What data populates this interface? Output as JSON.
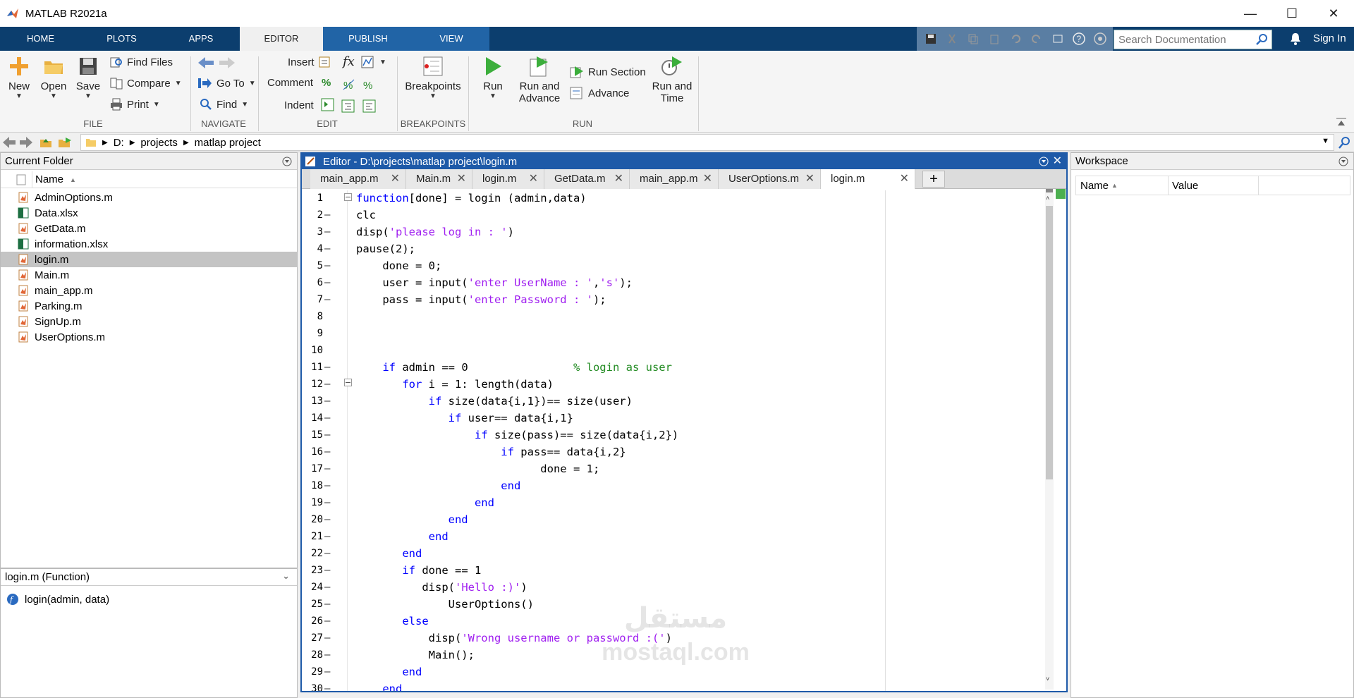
{
  "window": {
    "title": "MATLAB R2021a",
    "controls": {
      "minimize": "—",
      "maximize": "☐",
      "close": "✕"
    }
  },
  "tabs": [
    {
      "label": "HOME"
    },
    {
      "label": "PLOTS"
    },
    {
      "label": "APPS"
    },
    {
      "label": "EDITOR"
    },
    {
      "label": "PUBLISH"
    },
    {
      "label": "VIEW"
    }
  ],
  "search": {
    "placeholder": "Search Documentation"
  },
  "account": {
    "signin": "Sign In"
  },
  "ribbon": {
    "file": {
      "new": "New",
      "open": "Open",
      "save": "Save",
      "find_files": "Find Files",
      "compare": "Compare",
      "print": "Print",
      "section": "FILE"
    },
    "navigate": {
      "goto": "Go To",
      "find": "Find",
      "section": "NAVIGATE"
    },
    "edit": {
      "insert": "Insert",
      "comment": "Comment",
      "indent": "Indent",
      "fx": "fx",
      "pct": "%",
      "section": "EDIT"
    },
    "breakpoints": {
      "label": "Breakpoints",
      "section": "BREAKPOINTS"
    },
    "run": {
      "run": "Run",
      "run_and_advance_1": "Run and",
      "run_and_advance_2": "Advance",
      "run_section": "Run Section",
      "advance": "Advance",
      "run_and_time_1": "Run and",
      "run_and_time_2": "Time",
      "section": "RUN"
    }
  },
  "address": {
    "drive": "D:",
    "p1": "projects",
    "p2": "matlap project"
  },
  "current_folder": {
    "title": "Current Folder",
    "column_name": "Name",
    "files": [
      {
        "name": "AdminOptions.m",
        "type": "m"
      },
      {
        "name": "Data.xlsx",
        "type": "xlsx"
      },
      {
        "name": "GetData.m",
        "type": "m"
      },
      {
        "name": "information.xlsx",
        "type": "xlsx"
      },
      {
        "name": "login.m",
        "type": "m",
        "selected": true
      },
      {
        "name": "Main.m",
        "type": "m"
      },
      {
        "name": "main_app.m",
        "type": "m"
      },
      {
        "name": "Parking.m",
        "type": "m"
      },
      {
        "name": "SignUp.m",
        "type": "m"
      },
      {
        "name": "UserOptions.m",
        "type": "m"
      }
    ]
  },
  "details": {
    "title": "login.m  (Function)",
    "item": "login(admin, data)"
  },
  "editor": {
    "title": "Editor - D:\\projects\\matlap project\\login.m",
    "tabs": [
      "main_app.m",
      "Main.m",
      "login.m",
      "GetData.m",
      "main_app.m",
      "UserOptions.m",
      "login.m"
    ],
    "active_tab_index": 6,
    "lines": [
      {
        "n": "1",
        "dash": "",
        "parts": [
          [
            "kw",
            "function"
          ],
          [
            "",
            "[done] = login (admin,data)"
          ]
        ]
      },
      {
        "n": "2",
        "dash": "—",
        "parts": [
          [
            "",
            "clc"
          ]
        ]
      },
      {
        "n": "3",
        "dash": "—",
        "parts": [
          [
            "",
            "disp("
          ],
          [
            "str",
            "'please log in : '"
          ],
          [
            "",
            ")"
          ]
        ]
      },
      {
        "n": "4",
        "dash": "—",
        "parts": [
          [
            "",
            "pause(2);"
          ]
        ]
      },
      {
        "n": "5",
        "dash": "—",
        "parts": [
          [
            "",
            "    done = 0;"
          ]
        ]
      },
      {
        "n": "6",
        "dash": "—",
        "parts": [
          [
            "",
            "    user = input("
          ],
          [
            "str",
            "'enter UserName : '"
          ],
          [
            "",
            ","
          ],
          [
            "str",
            "'s'"
          ],
          [
            "",
            ");"
          ]
        ]
      },
      {
        "n": "7",
        "dash": "—",
        "parts": [
          [
            "",
            "    pass = input("
          ],
          [
            "str",
            "'enter Password : '"
          ],
          [
            "",
            ");"
          ]
        ]
      },
      {
        "n": "8",
        "dash": "",
        "parts": []
      },
      {
        "n": "9",
        "dash": "",
        "parts": []
      },
      {
        "n": "10",
        "dash": "",
        "parts": []
      },
      {
        "n": "11",
        "dash": "—",
        "parts": [
          [
            "kw",
            "    if"
          ],
          [
            "",
            " admin == 0                "
          ],
          [
            "cmt",
            "% login as user"
          ]
        ]
      },
      {
        "n": "12",
        "dash": "—",
        "parts": [
          [
            "kw",
            "       for"
          ],
          [
            "",
            " i = 1: length(data)"
          ]
        ]
      },
      {
        "n": "13",
        "dash": "—",
        "parts": [
          [
            "kw",
            "           if"
          ],
          [
            "",
            " size(data{i,1})== size(user)"
          ]
        ]
      },
      {
        "n": "14",
        "dash": "—",
        "parts": [
          [
            "kw",
            "              if"
          ],
          [
            "",
            " user== data{i,1}"
          ]
        ]
      },
      {
        "n": "15",
        "dash": "—",
        "parts": [
          [
            "kw",
            "                  if"
          ],
          [
            "",
            " size(pass)== size(data{i,2})"
          ]
        ]
      },
      {
        "n": "16",
        "dash": "—",
        "parts": [
          [
            "kw",
            "                      if"
          ],
          [
            "",
            " pass== data{i,2}"
          ]
        ]
      },
      {
        "n": "17",
        "dash": "—",
        "parts": [
          [
            "",
            "                            done = 1;"
          ]
        ]
      },
      {
        "n": "18",
        "dash": "—",
        "parts": [
          [
            "kw",
            "                      end"
          ]
        ]
      },
      {
        "n": "19",
        "dash": "—",
        "parts": [
          [
            "kw",
            "                  end"
          ]
        ]
      },
      {
        "n": "20",
        "dash": "—",
        "parts": [
          [
            "kw",
            "              end"
          ]
        ]
      },
      {
        "n": "21",
        "dash": "—",
        "parts": [
          [
            "kw",
            "           end"
          ]
        ]
      },
      {
        "n": "22",
        "dash": "—",
        "parts": [
          [
            "kw",
            "       end"
          ]
        ]
      },
      {
        "n": "23",
        "dash": "—",
        "parts": [
          [
            "kw",
            "       if"
          ],
          [
            "",
            " done == 1"
          ]
        ]
      },
      {
        "n": "24",
        "dash": "—",
        "parts": [
          [
            "",
            "          disp("
          ],
          [
            "str",
            "'Hello :)'"
          ],
          [
            "",
            ")"
          ]
        ]
      },
      {
        "n": "25",
        "dash": "—",
        "parts": [
          [
            "",
            "              UserOptions()"
          ]
        ]
      },
      {
        "n": "26",
        "dash": "—",
        "parts": [
          [
            "kw",
            "       else"
          ]
        ]
      },
      {
        "n": "27",
        "dash": "—",
        "parts": [
          [
            "",
            "           disp("
          ],
          [
            "str",
            "'Wrong username or password :('"
          ],
          [
            "",
            ")"
          ]
        ]
      },
      {
        "n": "28",
        "dash": "—",
        "parts": [
          [
            "",
            "           Main();"
          ]
        ]
      },
      {
        "n": "29",
        "dash": "—",
        "parts": [
          [
            "kw",
            "       end"
          ]
        ]
      },
      {
        "n": "30",
        "dash": "—",
        "parts": [
          [
            "kw",
            "    end"
          ]
        ]
      }
    ]
  },
  "workspace": {
    "title": "Workspace",
    "col_name": "Name",
    "col_value": "Value"
  },
  "watermark": {
    "ar": "مستقل",
    "en": "mostaql.com"
  },
  "colors": {
    "ribbon_tab_bg": "#0c3e6e",
    "active_tab": "#f0f0f0",
    "keyword": "#0000ff",
    "string": "#a020f0",
    "comment": "#228b22"
  }
}
